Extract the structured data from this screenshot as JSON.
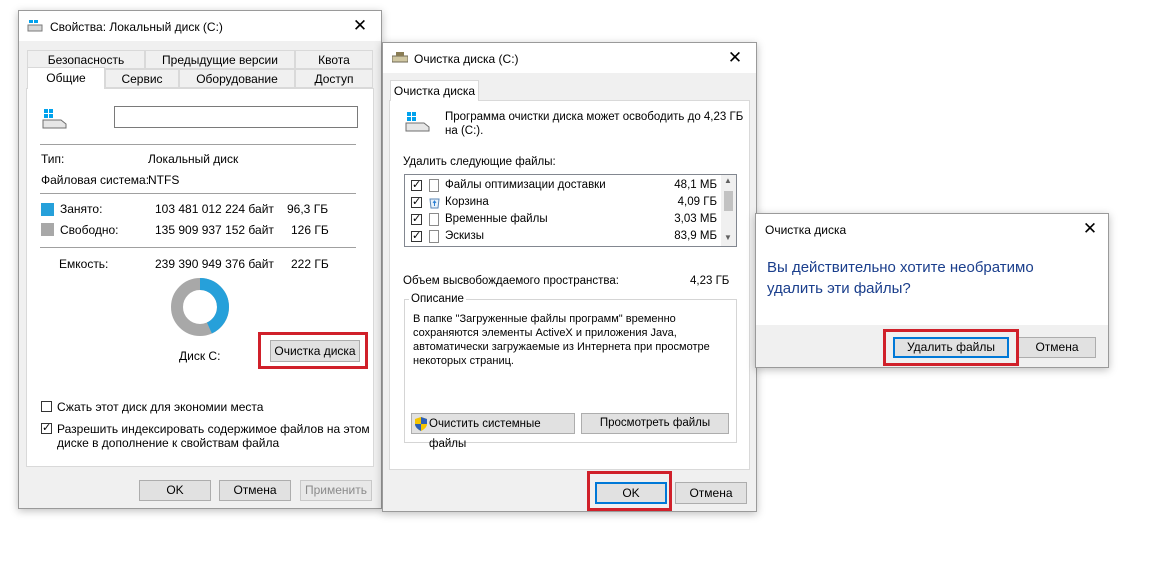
{
  "props": {
    "title": "Свойства: Локальный диск (C:)",
    "tabs_top": [
      "Безопасность",
      "Предыдущие версии",
      "Квота"
    ],
    "tabs_bottom": [
      "Общие",
      "Сервис",
      "Оборудование",
      "Доступ"
    ],
    "name_value": "",
    "type_label": "Тип:",
    "type_value": "Локальный диск",
    "fs_label": "Файловая система:",
    "fs_value": "NTFS",
    "used_label": "Занято:",
    "used_bytes": "103 481 012 224 байт",
    "used_gb": "96,3 ГБ",
    "free_label": "Свободно:",
    "free_bytes": "135 909 937 152 байт",
    "free_gb": "126 ГБ",
    "cap_label": "Емкость:",
    "cap_bytes": "239 390 949 376 байт",
    "cap_gb": "222 ГБ",
    "drive_label": "Диск C:",
    "cleanup_btn": "Очистка диска",
    "compress_label": "Сжать этот диск для экономии места",
    "index_label_1": "Разрешить индексировать содержимое файлов на этом",
    "index_label_2": "диске в дополнение к свойствам файла",
    "ok": "OK",
    "cancel": "Отмена",
    "apply": "Применить",
    "used_color": "#26a0da",
    "free_color": "#a8a8a8",
    "used_fraction": 0.432
  },
  "cleanup": {
    "title": "Очистка диска  (C:)",
    "tab": "Очистка диска",
    "desc_1": "Программа очистки диска может освободить до 4,23 ГБ",
    "desc_2": "на  (C:).",
    "delete_label": "Удалить следующие файлы:",
    "files": [
      {
        "name": "Файлы оптимизации доставки",
        "size": "48,1 МБ"
      },
      {
        "name": "Корзина",
        "size": "4,09 ГБ"
      },
      {
        "name": "Временные файлы",
        "size": "3,03 МБ"
      },
      {
        "name": "Эскизы",
        "size": "83,9 МБ"
      }
    ],
    "space_label": "Объем высвобождаемого пространства:",
    "space_value": "4,23 ГБ",
    "group_label": "Описание",
    "description": [
      "В папке \"Загруженные файлы программ\" временно",
      "сохраняются элементы ActiveX и приложения Java,",
      "автоматически загружаемые из Интернета при просмотре",
      "некоторых страниц."
    ],
    "system_btn": "Очистить системные файлы",
    "view_btn": "Просмотреть файлы",
    "ok": "OK",
    "cancel": "Отмена"
  },
  "confirm": {
    "title": "Очистка диска",
    "question_1": "Вы действительно хотите необратимо",
    "question_2": "удалить эти файлы?",
    "delete_btn": "Удалить файлы",
    "cancel": "Отмена"
  }
}
